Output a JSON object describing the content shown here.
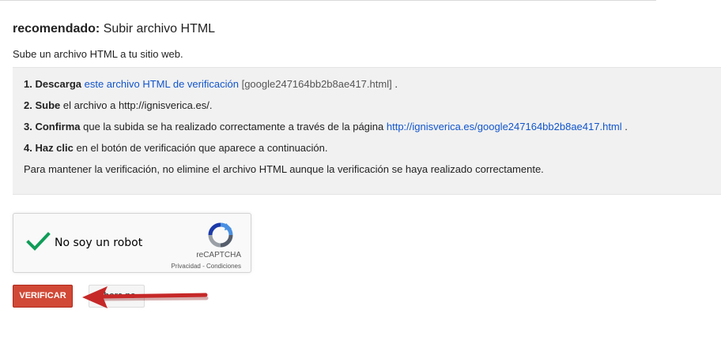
{
  "heading": {
    "bold": "recomendado:",
    "text": " Subir archivo HTML"
  },
  "intro": "Sube un archivo HTML a tu sitio web.",
  "steps": {
    "s1": {
      "bold": "1. Descarga",
      "link": "este archivo HTML de verificación",
      "file": "[google247164bb2b8ae417.html]",
      "end": " ."
    },
    "s2": {
      "bold": "2. Sube",
      "text": " el archivo a http://ignisverica.es/."
    },
    "s3": {
      "bold": "3. Confirma",
      "text": " que la subida se ha realizado correctamente a través de la página ",
      "link": "http://ignisverica.es/google247164bb2b8ae417.html",
      "end": " ."
    },
    "s4": {
      "bold": "4. Haz clic",
      "text": " en el botón de verificación que aparece a continuación."
    },
    "note": "Para mantener la verificación, no elimine el archivo HTML aunque la verificación se haya realizado correctamente."
  },
  "captcha": {
    "label": "No soy un robot",
    "brand": "reCAPTCHA",
    "privacy": "Privacidad",
    "separator": " - ",
    "terms": "Condiciones",
    "checked": true,
    "icon": "recaptcha-logo-icon"
  },
  "buttons": {
    "verify": "VERIFICAR",
    "later": "Ahora no"
  },
  "colors": {
    "link": "#1155cc",
    "verify_button": "#d14836",
    "check": "#0f9d58",
    "arrow": "#c62828"
  }
}
